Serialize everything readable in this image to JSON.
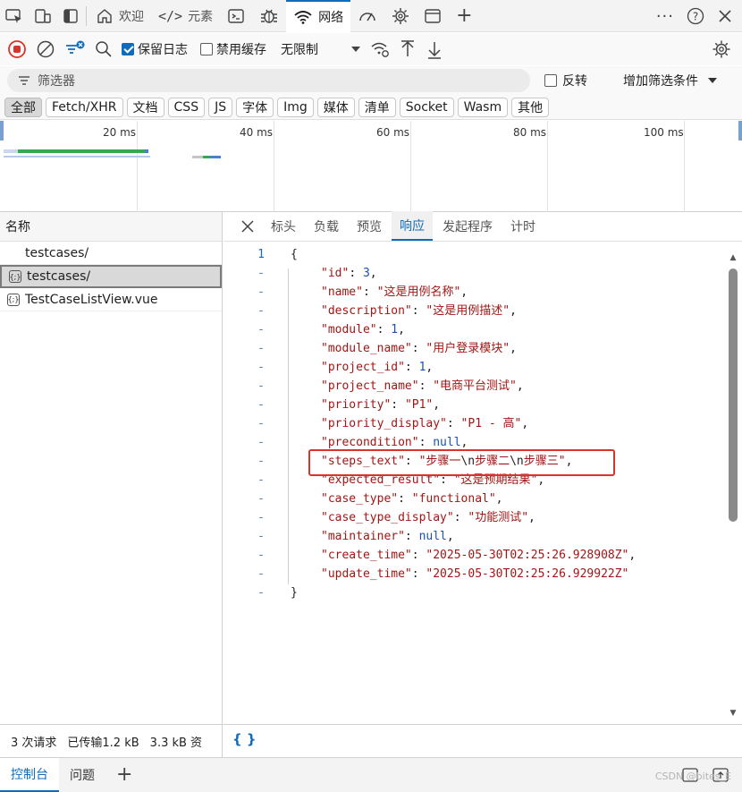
{
  "tabbar": {
    "tabs": [
      {
        "label": "欢迎",
        "icon": "home-icon"
      },
      {
        "label": "元素",
        "icon": "code-tag-icon"
      },
      {
        "label": "",
        "icon": "console-icon"
      },
      {
        "label": "",
        "icon": "bug-icon"
      },
      {
        "label": "网络",
        "icon": "wifi-icon"
      },
      {
        "label": "",
        "icon": "performance-icon"
      },
      {
        "label": "",
        "icon": "settings-gear-icon"
      },
      {
        "label": "",
        "icon": "application-icon"
      }
    ],
    "active_tab": "网络"
  },
  "toolbar": {
    "preserve_log_label": "保留日志",
    "preserve_log_checked": true,
    "disable_cache_label": "禁用缓存",
    "disable_cache_checked": false,
    "throttle_label": "无限制"
  },
  "filter": {
    "placeholder": "筛选器",
    "invert_label": "反转",
    "invert_checked": false,
    "more_filters_label": "增加筛选条件"
  },
  "type_chips": [
    "全部",
    "Fetch/XHR",
    "文档",
    "CSS",
    "JS",
    "字体",
    "Img",
    "媒体",
    "清单",
    "Socket",
    "Wasm",
    "其他"
  ],
  "overview": {
    "ticks": [
      "20 ms",
      "40 ms",
      "60 ms",
      "80 ms",
      "100 ms"
    ]
  },
  "request_list": {
    "header": "名称",
    "items": [
      {
        "name": "testcases/",
        "icon": ""
      },
      {
        "name": "testcases/",
        "icon": "{;}",
        "selected": true
      },
      {
        "name": "TestCaseListView.vue",
        "icon": "{;}"
      }
    ]
  },
  "detail_tabs": [
    "标头",
    "负载",
    "预览",
    "响应",
    "发起程序",
    "计时"
  ],
  "active_detail_tab": "响应",
  "response": {
    "gutter_first": "1",
    "gutter_other": "-",
    "open_brace": "{",
    "close_brace": "}",
    "fields": [
      {
        "key": "\"id\"",
        "value": "3",
        "type": "num"
      },
      {
        "key": "\"name\"",
        "value": "\"这是用例名称\"",
        "type": "str"
      },
      {
        "key": "\"description\"",
        "value": "\"这是用例描述\"",
        "type": "str"
      },
      {
        "key": "\"module\"",
        "value": "1",
        "type": "num"
      },
      {
        "key": "\"module_name\"",
        "value": "\"用户登录模块\"",
        "type": "str"
      },
      {
        "key": "\"project_id\"",
        "value": "1",
        "type": "num"
      },
      {
        "key": "\"project_name\"",
        "value": "\"电商平台测试\"",
        "type": "str"
      },
      {
        "key": "\"priority\"",
        "value": "\"P1\"",
        "type": "str"
      },
      {
        "key": "\"priority_display\"",
        "value": "\"P1 - 高\"",
        "type": "str"
      },
      {
        "key": "\"precondition\"",
        "value": "null",
        "type": "kw"
      },
      {
        "key": "\"steps_text\"",
        "value": "\"步骤一\\n步骤二\\n步骤三\"",
        "type": "str"
      },
      {
        "key": "\"expected_result\"",
        "value": "\"这是预期结果\"",
        "type": "str"
      },
      {
        "key": "\"case_type\"",
        "value": "\"functional\"",
        "type": "str"
      },
      {
        "key": "\"case_type_display\"",
        "value": "\"功能测试\"",
        "type": "str"
      },
      {
        "key": "\"maintainer\"",
        "value": "null",
        "type": "kw"
      },
      {
        "key": "\"create_time\"",
        "value": "\"2025-05-30T02:25:26.928908Z\"",
        "type": "str"
      },
      {
        "key": "\"update_time\"",
        "value": "\"2025-05-30T02:25:26.929922Z\"",
        "type": "str"
      }
    ]
  },
  "status": {
    "requests": "3 次请求",
    "transferred": "已传输1.2 kB",
    "resources": "3.3 kB 资",
    "pretty_print": "{ }"
  },
  "drawer": {
    "tabs": [
      "控制台",
      "问题"
    ],
    "active": "控制台",
    "watermark": "CSDN @bites_E"
  },
  "colors": {
    "accent": "#0f6cbd",
    "highlight_box": "#d9342b",
    "json_string": "#a31515",
    "json_number": "#1850b8"
  }
}
